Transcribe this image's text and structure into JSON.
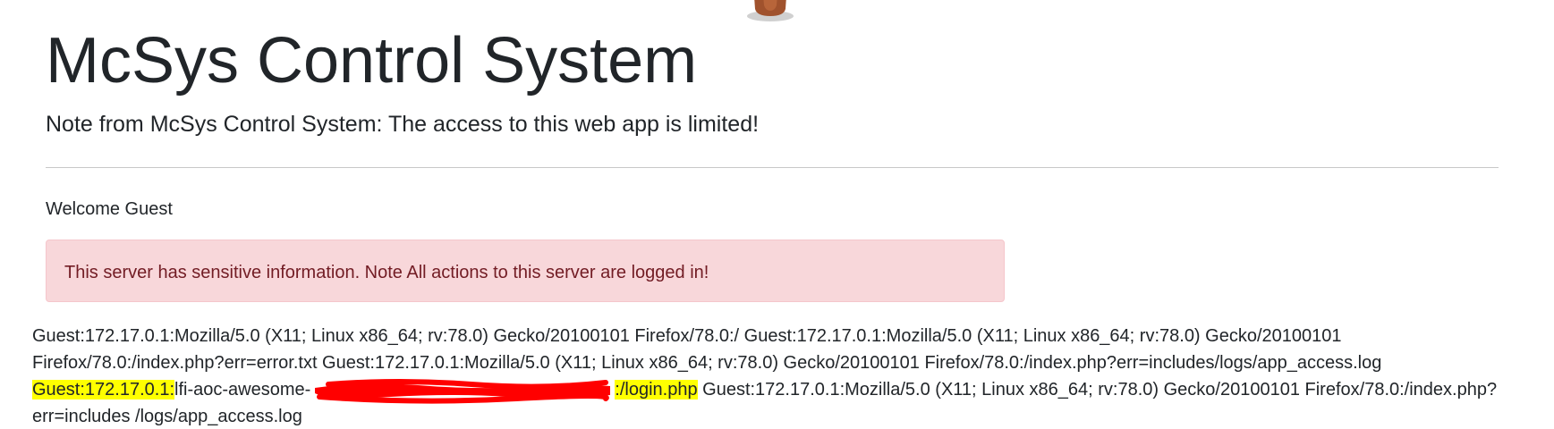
{
  "header": {
    "title": "McSys Control System",
    "subtitle": "Note from McSys Control System: The access to this web app is limited!"
  },
  "main": {
    "welcome": "Welcome Guest",
    "alert": "This server has sensitive information. Note All actions to this server are logged in!"
  },
  "log": {
    "part1": "Guest:172.17.0.1:Mozilla/5.0 (X11; Linux x86_64; rv:78.0) Gecko/20100101 Firefox/78.0:/ Guest:172.17.0.1:Mozilla/5.0 (X11; Linux x86_64; rv:78.0) Gecko/20100101 Firefox/78.0:/index.php?err=error.txt Guest:172.17.0.1:Mozilla/5.0 (X11; Linux x86_64; rv:78.0) Gecko/20100101 Firefox/78.0:/index.php?err=includes/logs/app_access.log ",
    "highlight1": "Guest:172.17.0.1:",
    "part2": "lfi-aoc-awesome-",
    "highlight2": ":/login.php",
    "part3": " Guest:172.17.0.1:Mozilla/5.0 (X11; Linux x86_64; rv:78.0) Gecko/20100101 Firefox/78.0:/index.php?err=includes /logs/app_access.log"
  },
  "colors": {
    "alert_bg": "#f8d7da",
    "alert_text": "#721c24",
    "highlight": "#ffff00",
    "redaction": "#ff0000"
  }
}
